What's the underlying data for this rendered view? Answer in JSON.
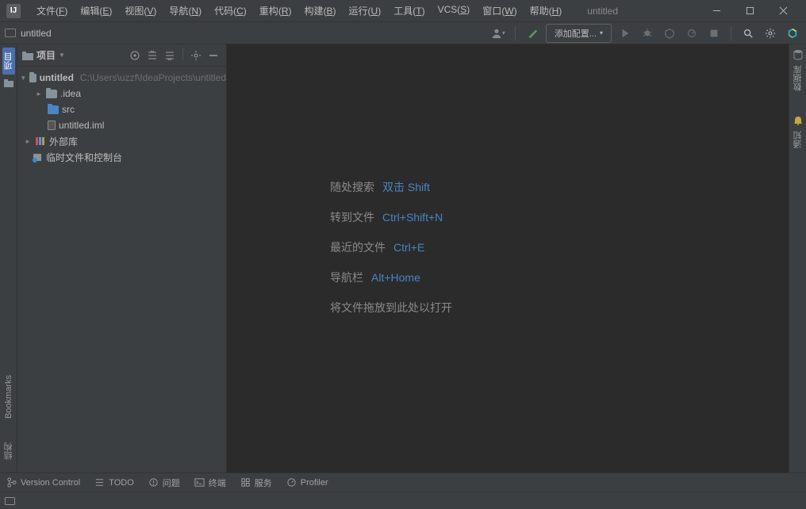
{
  "title": {
    "project": "untitled"
  },
  "menu": [
    {
      "label": "文件",
      "key": "F"
    },
    {
      "label": "编辑",
      "key": "E"
    },
    {
      "label": "视图",
      "key": "V"
    },
    {
      "label": "导航",
      "key": "N"
    },
    {
      "label": "代码",
      "key": "C"
    },
    {
      "label": "重构",
      "key": "R"
    },
    {
      "label": "构建",
      "key": "B"
    },
    {
      "label": "运行",
      "key": "U"
    },
    {
      "label": "工具",
      "key": "T"
    },
    {
      "label": "VCS",
      "key": "S"
    },
    {
      "label": "窗口",
      "key": "W"
    },
    {
      "label": "帮助",
      "key": "H"
    }
  ],
  "breadcrumb": "untitled",
  "run_config": "添加配置...",
  "left_tabs": {
    "project": "项目",
    "structure": "结构",
    "bookmarks": "Bookmarks"
  },
  "right_tabs": {
    "database": "数据库",
    "notifications": "通知"
  },
  "panel": {
    "title": "项目",
    "tree": {
      "root": {
        "name": "untitled",
        "path": "C:\\Users\\uzzf\\IdeaProjects\\untitled"
      },
      "idea": ".idea",
      "src": "src",
      "iml": "untitled.iml",
      "external": "外部库",
      "scratch": "临时文件和控制台"
    }
  },
  "tips": [
    {
      "label": "随处搜索",
      "shortcut": "双击 Shift"
    },
    {
      "label": "转到文件",
      "shortcut": "Ctrl+Shift+N"
    },
    {
      "label": "最近的文件",
      "shortcut": "Ctrl+E"
    },
    {
      "label": "导航栏",
      "shortcut": "Alt+Home"
    }
  ],
  "drop_hint": "将文件拖放到此处以打开",
  "bottom": {
    "vcs": "Version Control",
    "todo": "TODO",
    "problems": "问题",
    "terminal": "终端",
    "services": "服务",
    "profiler": "Profiler"
  }
}
